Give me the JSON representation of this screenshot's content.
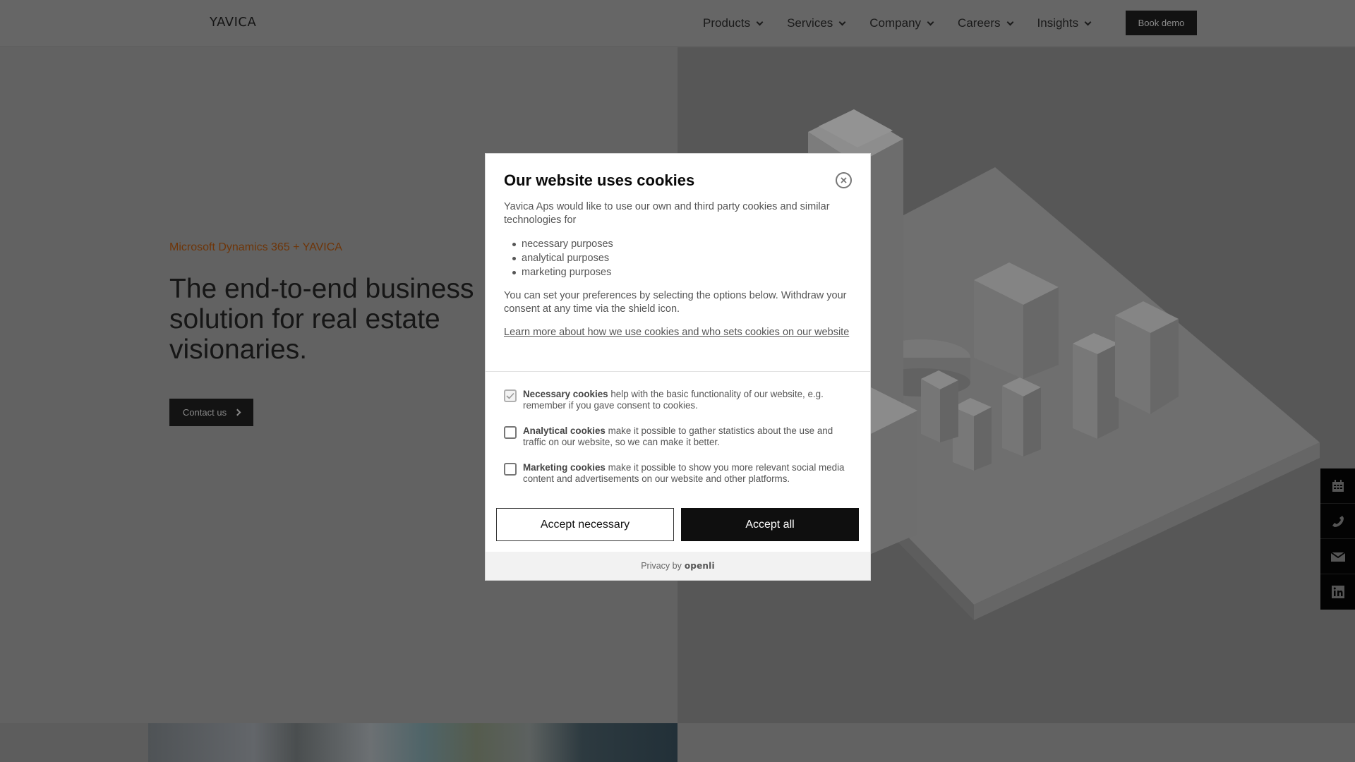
{
  "header": {
    "logo": "YAVICA",
    "nav": [
      {
        "label": "Products"
      },
      {
        "label": "Services"
      },
      {
        "label": "Company"
      },
      {
        "label": "Careers"
      },
      {
        "label": "Insights"
      }
    ],
    "cta_label": "Book demo"
  },
  "hero": {
    "eyebrow": "Microsoft Dynamics 365 + YAVICA",
    "title": "The end-to-end business solution for real estate visionaries.",
    "contact_label": "Contact us",
    "image_alt": "isometric-city-model"
  },
  "side_dock": {
    "icons": [
      "calendar-icon",
      "phone-icon",
      "mail-icon",
      "linkedin-icon"
    ]
  },
  "cookie_modal": {
    "title": "Our website uses cookies",
    "intro": "Yavica Aps would like to use our own and third party cookies and similar technologies for",
    "purposes": [
      "necessary purposes",
      "analytical purposes",
      "marketing purposes"
    ],
    "preferences_text": "You can set your preferences by selecting the options below. Withdraw your consent at any time via the shield icon.",
    "learn_more_link": "Learn more about how we use cookies and who sets cookies on our website",
    "options": [
      {
        "name": "Necessary cookies",
        "description": " help with the basic functionality of our website, e.g. remember if you gave consent to cookies.",
        "checked": true,
        "disabled": true
      },
      {
        "name": "Analytical cookies",
        "description": " make it possible to gather statistics about the use and traffic on our website, so we can make it better.",
        "checked": false,
        "disabled": false
      },
      {
        "name": "Marketing cookies",
        "description": " make it possible to show you more relevant social media content and advertisements on our website and other platforms.",
        "checked": false,
        "disabled": false
      }
    ],
    "accept_necessary_label": "Accept necessary",
    "accept_all_label": "Accept all",
    "footer_prefix": "Privacy by",
    "footer_brand": "openli"
  },
  "colors": {
    "eyebrow_accent": "#6e3508",
    "overlay_dim": "#626262",
    "primary_button": "#0f0f0f"
  }
}
